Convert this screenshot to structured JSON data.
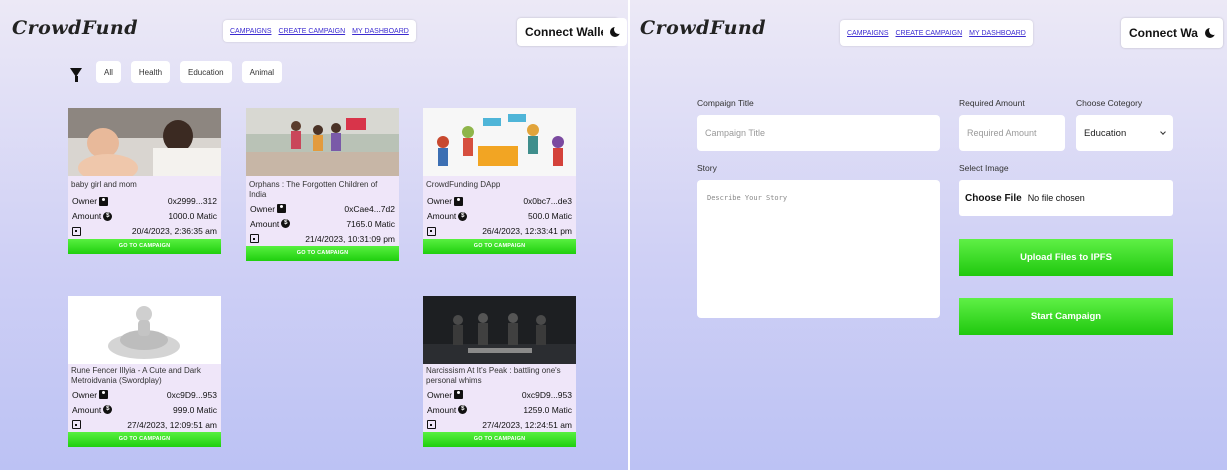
{
  "app": {
    "logo": "CrowdFund"
  },
  "nav": {
    "campaigns": "CAMPAIGNS",
    "create": "CREATE CAMPAIGN",
    "dashboard": "MY DASHBOARD"
  },
  "wallet": {
    "label": "Connect Wallet"
  },
  "filters": [
    "All",
    "Health",
    "Education",
    "Animal"
  ],
  "cards": [
    {
      "title": "baby girl and mom",
      "owner_label": "Owner",
      "owner": "0x2999...312",
      "amount_label": "Amount",
      "amount": "1000.0 Matic",
      "date": "20/4/2023, 2:36:35 am",
      "button": "GO TO CAMPAIGN"
    },
    {
      "title": "Orphans : The Forgotten Children of India",
      "owner_label": "Owner",
      "owner": "0xCae4...7d2",
      "amount_label": "Amount",
      "amount": "7165.0 Matic",
      "date": "21/4/2023, 10:31:09 pm",
      "button": "GO TO CAMPAIGN"
    },
    {
      "title": "CrowdFunding DApp",
      "owner_label": "Owner",
      "owner": "0x0bc7...de3",
      "amount_label": "Amount",
      "amount": "500.0 Matic",
      "date": "26/4/2023, 12:33:41 pm",
      "button": "GO TO CAMPAIGN"
    },
    {
      "title": "Rune Fencer Illyia - A Cute and Dark Metroidvania (Swordplay)",
      "owner_label": "Owner",
      "owner": "0xc9D9...953",
      "amount_label": "Amount",
      "amount": "999.0 Matic",
      "date": "27/4/2023, 12:09:51 am",
      "button": "GO TO CAMPAIGN"
    },
    {
      "title": "Narcissism At It's Peak : battling one's personal whims",
      "owner_label": "Owner",
      "owner": "0xc9D9...953",
      "amount_label": "Amount",
      "amount": "1259.0 Matic",
      "date": "27/4/2023, 12:24:51 am",
      "button": "GO TO CAMPAIGN"
    }
  ],
  "form": {
    "title_label": "Compaign Title",
    "title_placeholder": "Campaign Title",
    "amount_label": "Required Amount",
    "amount_placeholder": "Required Amount",
    "category_label": "Choose Cotegory",
    "category_value": "Education",
    "story_label": "Story",
    "story_placeholder": "Describe Your Story",
    "image_label": "Select Image",
    "file_button": "Choose File",
    "file_status": "No file chosen",
    "upload_button": "Upload Files to IPFS",
    "start_button": "Start Campaign"
  },
  "colors": {
    "accent_green": "#2bd91a",
    "nav_link": "#3b2bd0",
    "card_bg": "#efe6f9"
  }
}
